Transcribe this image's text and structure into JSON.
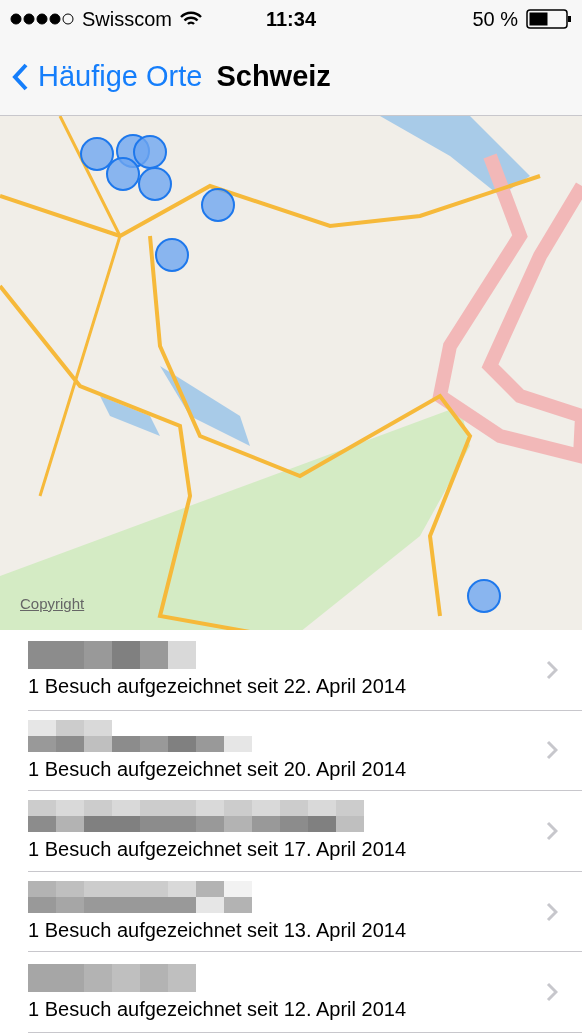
{
  "status_bar": {
    "carrier": "Swisscom",
    "time": "11:34",
    "battery": "50 %"
  },
  "nav": {
    "back": "Häufige Orte",
    "title": "Schweiz"
  },
  "map": {
    "kind": "picture",
    "copyright": "Copyright"
  },
  "places": [
    {
      "subtitle": "1 Besuch aufgezeichnet seit 22. April 2014"
    },
    {
      "subtitle": "1 Besuch aufgezeichnet seit 20. April 2014"
    },
    {
      "subtitle": "1 Besuch aufgezeichnet seit 17. April 2014"
    },
    {
      "subtitle": "1 Besuch aufgezeichnet seit 13. April 2014"
    },
    {
      "subtitle": "1 Besuch aufgezeichnet seit 12. April 2014"
    }
  ]
}
